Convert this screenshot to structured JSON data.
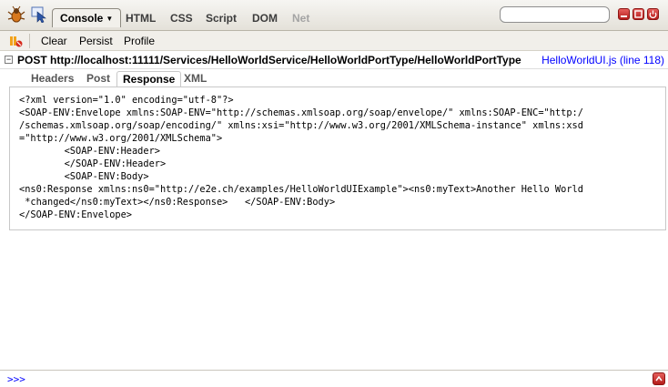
{
  "toolbar": {
    "console_label": "Console",
    "tabs": [
      "HTML",
      "CSS",
      "Script",
      "DOM",
      "Net"
    ],
    "search_placeholder": ""
  },
  "subbar": {
    "clear_label": "Clear",
    "persist_label": "Persist",
    "profile_label": "Profile"
  },
  "request": {
    "url": "POST http://localhost:11111/Services/HelloWorldService/HelloWorldPortType/HelloWorldPortType",
    "source": "HelloWorldUI.js (line 118)"
  },
  "netinfo": {
    "tabs": [
      "Headers",
      "Post",
      "Response",
      "XML"
    ],
    "active_tab": "Response"
  },
  "response": {
    "body": "<?xml version=\"1.0\" encoding=\"utf-8\"?>\n<SOAP-ENV:Envelope xmlns:SOAP-ENV=\"http://schemas.xmlsoap.org/soap/envelope/\" xmlns:SOAP-ENC=\"http:/\n/schemas.xmlsoap.org/soap/encoding/\" xmlns:xsi=\"http://www.w3.org/2001/XMLSchema-instance\" xmlns:xsd\n=\"http://www.w3.org/2001/XMLSchema\">\n        <SOAP-ENV:Header>\n        </SOAP-ENV:Header>\n        <SOAP-ENV:Body>\n<ns0:Response xmlns:ns0=\"http://e2e.ch/examples/HelloWorldUIExample\"><ns0:myText>Another Hello World\n *changed</ns0:myText></ns0:Response>   </SOAP-ENV:Body>\n</SOAP-ENV:Envelope>"
  },
  "commandline": {
    "prompt": ">>>"
  },
  "colors": {
    "link": "#0000ff",
    "close_red": "#c9302c",
    "toolbar_bg": "#e9e7e1"
  }
}
